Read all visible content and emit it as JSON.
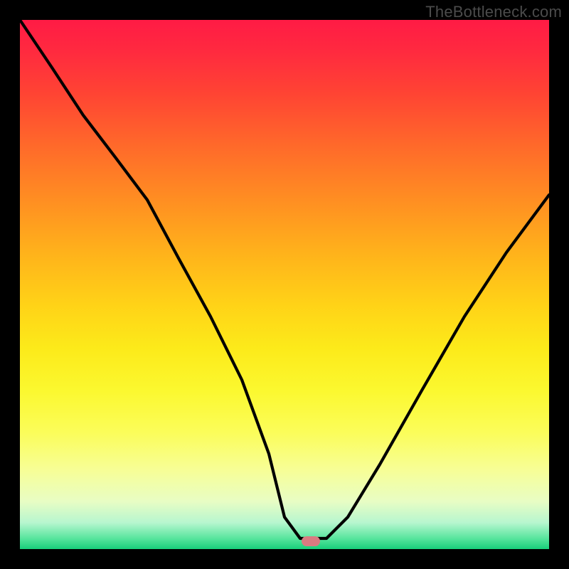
{
  "watermark": "TheBottleneck.com",
  "colors": {
    "background": "#000000",
    "curve": "#000000",
    "marker": "#d97b81",
    "gradient_stops": [
      "#ff1b45",
      "#ff2a3f",
      "#ff4433",
      "#ff6a2a",
      "#ff8e22",
      "#ffb21b",
      "#ffd317",
      "#fcea1a",
      "#fbf82f",
      "#fbfd5a",
      "#f7fe96",
      "#e8fdc4",
      "#b7f6cf",
      "#57e59d",
      "#18cf7a"
    ]
  },
  "chart_data": {
    "type": "line",
    "xlim": [
      0,
      100
    ],
    "ylim": [
      0,
      100
    ],
    "xlabel": "",
    "ylabel": "",
    "title": "",
    "grid": false,
    "series": [
      {
        "name": "bottleneck-curve",
        "x": [
          0,
          6,
          12,
          18,
          24,
          30,
          36,
          42,
          47,
          50,
          53,
          55,
          58,
          62,
          68,
          76,
          84,
          92,
          100
        ],
        "values": [
          100,
          91,
          82,
          74,
          66,
          55,
          44,
          32,
          18,
          6,
          2,
          2,
          2,
          6,
          16,
          30,
          44,
          56,
          67
        ]
      }
    ],
    "marker": {
      "x": 55,
      "y": 1.5
    },
    "flat_bottom_x_range": [
      50,
      57
    ]
  }
}
